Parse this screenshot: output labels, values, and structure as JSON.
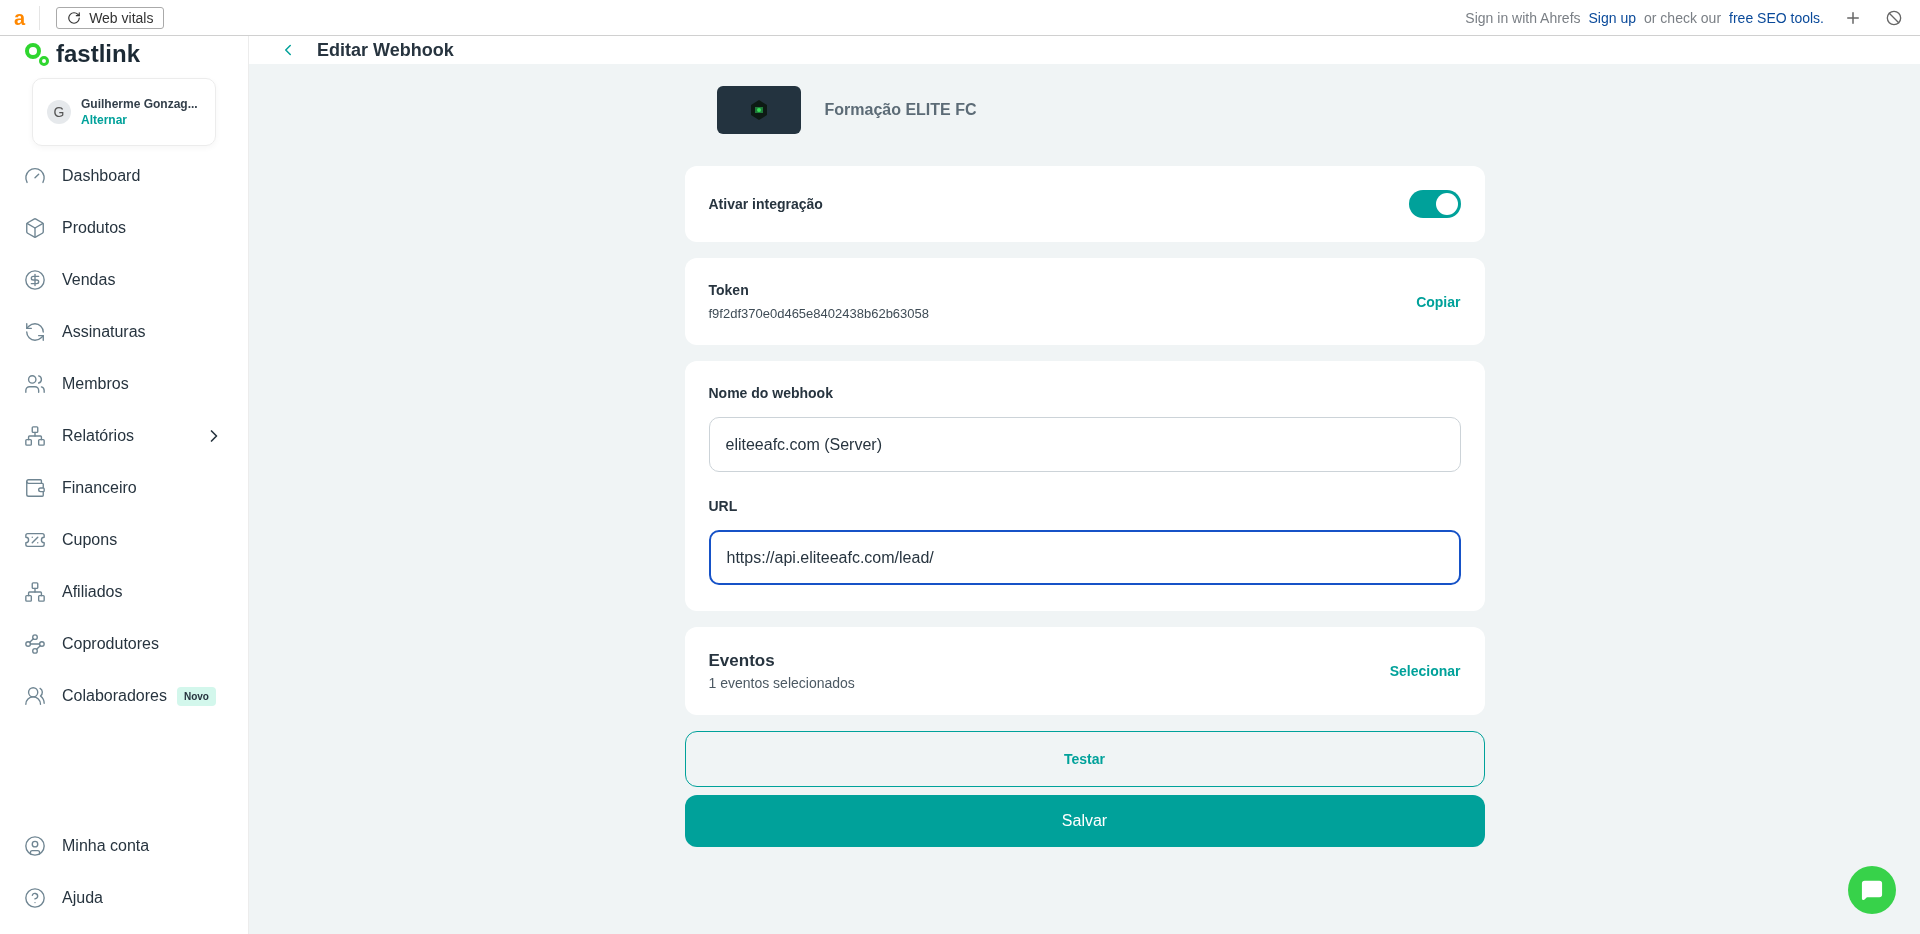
{
  "extension_bar": {
    "logo": "a",
    "button": "Web vitals",
    "sign_in": "Sign in with Ahrefs",
    "sign_up": "Sign up",
    "middle": "or check our",
    "tools_link": "free SEO tools."
  },
  "sidebar": {
    "brand": "fastlink",
    "user": {
      "initial": "G",
      "name": "Guilherme Gonzag...",
      "action": "Alternar"
    },
    "items": [
      {
        "label": "Dashboard",
        "expandable": false
      },
      {
        "label": "Produtos",
        "expandable": false
      },
      {
        "label": "Vendas",
        "expandable": false
      },
      {
        "label": "Assinaturas",
        "expandable": false
      },
      {
        "label": "Membros",
        "expandable": false
      },
      {
        "label": "Relatórios",
        "expandable": true
      },
      {
        "label": "Financeiro",
        "expandable": false
      },
      {
        "label": "Cupons",
        "expandable": false
      },
      {
        "label": "Afiliados",
        "expandable": false
      },
      {
        "label": "Coprodutores",
        "expandable": false
      },
      {
        "label": "Colaboradores",
        "expandable": false,
        "badge": "Novo"
      }
    ],
    "bottom_items": [
      {
        "label": "Minha conta"
      },
      {
        "label": "Ajuda"
      }
    ]
  },
  "header": {
    "title": "Editar Webhook"
  },
  "product": {
    "name": "Formação ELITE FC"
  },
  "integration": {
    "label": "Ativar integração",
    "on": true
  },
  "token": {
    "label": "Token",
    "value": "f9f2df370e0d465e8402438b62b63058",
    "action": "Copiar"
  },
  "form": {
    "fields": [
      {
        "label": "Nome do webhook",
        "value": "eliteeafc.com (Server)",
        "focused": false
      },
      {
        "label": "URL",
        "value": "https://api.eliteeafc.com/lead/",
        "focused": true
      }
    ]
  },
  "events": {
    "title": "Eventos",
    "summary": "1 eventos selecionados",
    "action": "Selecionar"
  },
  "buttons": {
    "test": "Testar",
    "save": "Salvar"
  }
}
